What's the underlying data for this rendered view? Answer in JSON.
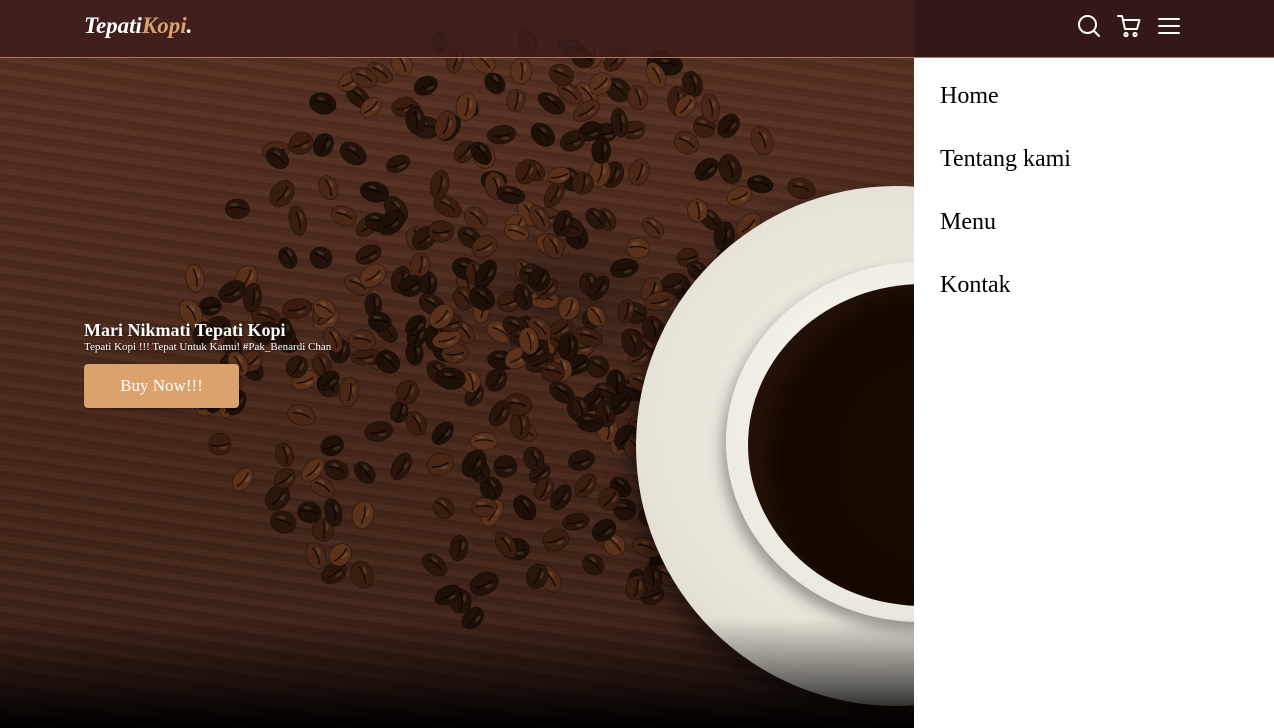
{
  "brand": {
    "name": "Tepati",
    "accent": "Kopi",
    "suffix": "."
  },
  "nav_icons": [
    "search-icon",
    "shopping-cart-icon",
    "hamburger-menu-icon"
  ],
  "menu": {
    "items": [
      "Home",
      "Tentang kami",
      "Menu",
      "Kontak"
    ]
  },
  "hero": {
    "title": "Mari Nikmati Tepati Kopi",
    "subtitle": "Tepati Kopi !!! Tepat Untuk Kamu! #Pak_Benardi Chan",
    "cta": "Buy Now!!!"
  },
  "colors": {
    "accent": "#dca26e",
    "navbar": "#3c1c1c",
    "menu_bg": "#ffffff"
  }
}
